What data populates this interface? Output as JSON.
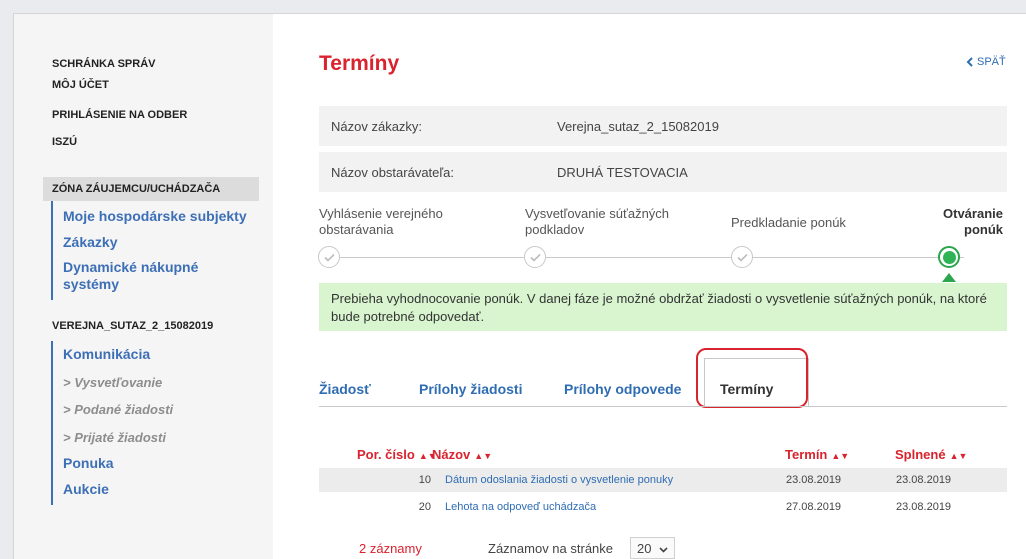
{
  "sidebar": {
    "top_links": [
      "SCHRÁNKA SPRÁV",
      "MÔJ ÚČET",
      "PRIHLÁSENIE NA ODBER",
      "ISZÚ"
    ],
    "zone_title": "ZÓNA ZÁUJEMCU/UCHÁDZAČA",
    "zone_items": [
      "Moje hospodárske subjekty",
      "Zákazky",
      "Dynamické nákupné systémy"
    ],
    "contract_title": "VEREJNA_SUTAZ_2_15082019",
    "contract_items": {
      "komunikacia": "Komunikácia",
      "vysvetlovanie": "> Vysvetľovanie",
      "podane": "> Podané žiadosti",
      "prijate": "> Prijaté žiadosti",
      "ponuka": "Ponuka",
      "aukcie": "Aukcie"
    }
  },
  "page": {
    "title": "Termíny",
    "back_label": "SPÄŤ",
    "info": [
      {
        "label": "Názov zákazky:",
        "value": "Verejna_sutaz_2_15082019"
      },
      {
        "label": "Názov obstarávateľa:",
        "value": "DRUHÁ TESTOVACIA"
      }
    ],
    "steps": [
      {
        "label": "Vyhlásenie verejného obstarávania",
        "state": "done"
      },
      {
        "label": "Vysvetľovanie súťažných podkladov",
        "state": "done"
      },
      {
        "label": "Predkladanie ponúk",
        "state": "done"
      },
      {
        "label": "Otváranie ponúk",
        "state": "active"
      }
    ],
    "alert": "Prebieha vyhodnocovanie ponúk. V danej fáze je možné obdržať žiadosti o vysvetlenie súťažných ponúk, na ktoré bude potrebné odpovedať.",
    "tabs": [
      "Žiadosť",
      "Prílohy žiadosti",
      "Prílohy odpovede",
      "Termíny"
    ],
    "active_tab": "Termíny",
    "table": {
      "headers": [
        "Por. číslo",
        "Názov",
        "Termín",
        "Splnené"
      ],
      "rows": [
        {
          "num": "10",
          "name": "Dátum odoslania žiadosti o vysvetlenie ponuky",
          "term": "23.08.2019",
          "done": "23.08.2019"
        },
        {
          "num": "20",
          "name": "Lehota na odpoveď uchádzača",
          "term": "27.08.2019",
          "done": "23.08.2019"
        }
      ]
    },
    "footer": {
      "count": "2 záznamy",
      "per_page_label": "Záznamov na stránke",
      "per_page_value": "20"
    }
  },
  "colors": {
    "accent_red": "#d9232e",
    "link_blue": "#2f6db3",
    "success_green": "#2ca64d",
    "alert_bg": "#d8f5cf"
  }
}
